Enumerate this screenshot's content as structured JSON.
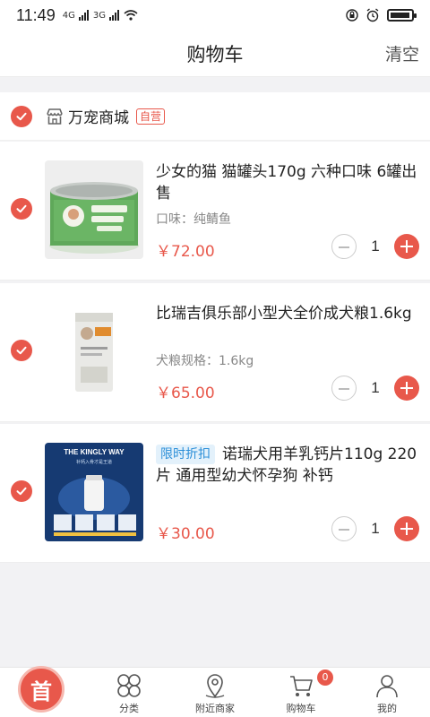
{
  "status": {
    "time": "11:49",
    "sig1": "4G",
    "sig2": "3G"
  },
  "nav": {
    "title": "购物车",
    "clear": "清空"
  },
  "shop": {
    "name": "万宠商城",
    "badge": "自营"
  },
  "items": [
    {
      "title": "少女的猫 猫罐头170g 六种口味 6罐出售",
      "spec": "口味：纯鲭鱼",
      "price": "￥72.00",
      "qty": "1",
      "promo": ""
    },
    {
      "title": "比瑞吉俱乐部小型犬全价成犬粮1.6kg",
      "spec": "犬粮规格：1.6kg",
      "price": "￥65.00",
      "qty": "1",
      "promo": ""
    },
    {
      "title": "诺瑞犬用羊乳钙片110g 220片 通用型幼犬怀孕狗 补钙",
      "spec": "",
      "price": "￥30.00",
      "qty": "1",
      "promo": "限时折扣"
    }
  ],
  "product_image_text": {
    "item3_brand": "THE KINGLY WAY",
    "item3_sub": "补钙入骨才是王道"
  },
  "tabbar": {
    "home": "首",
    "tabs": [
      {
        "label": "分类"
      },
      {
        "label": "附近商家"
      },
      {
        "label": "购物车"
      },
      {
        "label": "我的"
      }
    ],
    "cart_count": "0"
  },
  "colors": {
    "accent": "#e8584b",
    "promo_bg": "#e3f1fb",
    "promo_text": "#2c8fd8"
  }
}
